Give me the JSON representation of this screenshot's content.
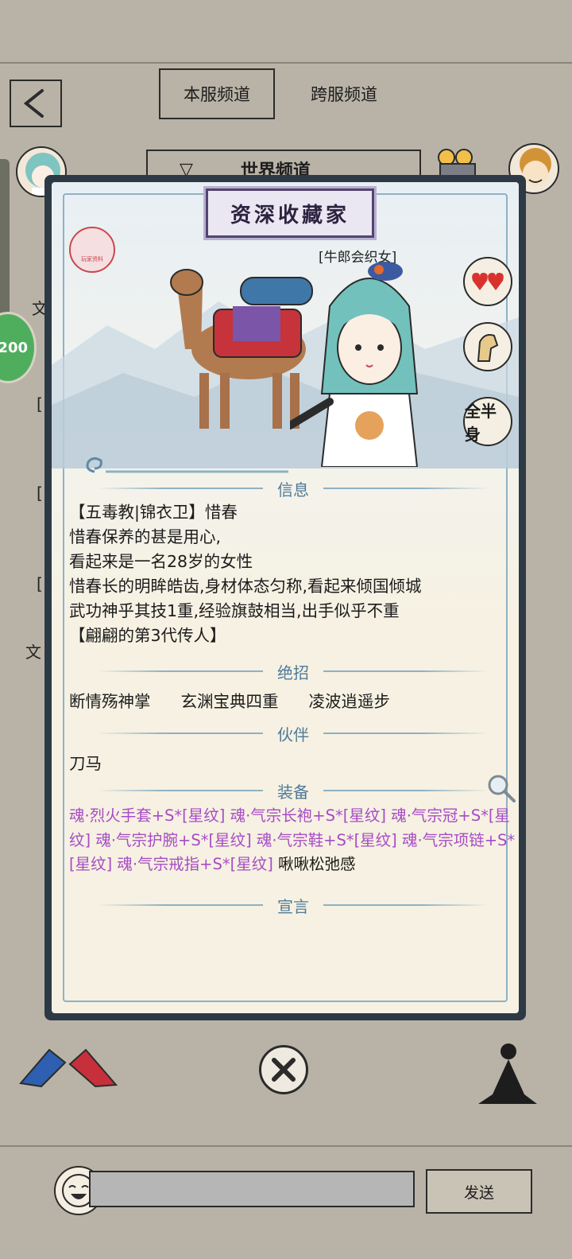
{
  "tabs": {
    "server": "本服频道",
    "cross": "跨服频道"
  },
  "world_channel": "世界频道",
  "side_badge": "200",
  "background_chars": [
    "文",
    "[",
    "[",
    "[",
    "文"
  ],
  "popup": {
    "title": "资深收藏家",
    "seal_text": "玩家资料",
    "character_title": "[牛郎会织女]",
    "side_buttons": {
      "likes": "heart-icon",
      "mount": "horse-icon",
      "full_body": "全半身"
    },
    "sections": {
      "info": "信息",
      "skills": "绝招",
      "partner": "伙伴",
      "equipment": "装备",
      "declaration": "宣言"
    },
    "info_lines": [
      "【五毒教|锦衣卫】惜春",
      "惜春保养的甚是用心,",
      "看起来是一名28岁的女性",
      "惜春长的明眸皓齿,身材体态匀称,看起来倾国倾城",
      "武功神乎其技1重,经验旗鼓相当,出手似乎不重",
      "【翩翩的第3代传人】"
    ],
    "skills": [
      "断情殇神掌",
      "玄渊宝典四重",
      "凌波逍遥步"
    ],
    "partner": "刀马",
    "equipment": [
      "魂·烈火手套+S*[星纹]",
      "魂·气宗长袍+S*[星纹]",
      "魂·气宗冠+S*[星纹]",
      "魂·气宗护腕+S*[星纹]",
      "魂·气宗鞋+S*[星纹]",
      "魂·气宗项链+S*[星纹]",
      "魂·气宗戒指+S*[星纹]"
    ],
    "equipment_tail": "啾啾松弛感"
  },
  "footer": {
    "send": "发送"
  },
  "colors": {
    "section": "#4f7a99",
    "equipment": "#a74bc6",
    "frame": "#2d3a46"
  }
}
